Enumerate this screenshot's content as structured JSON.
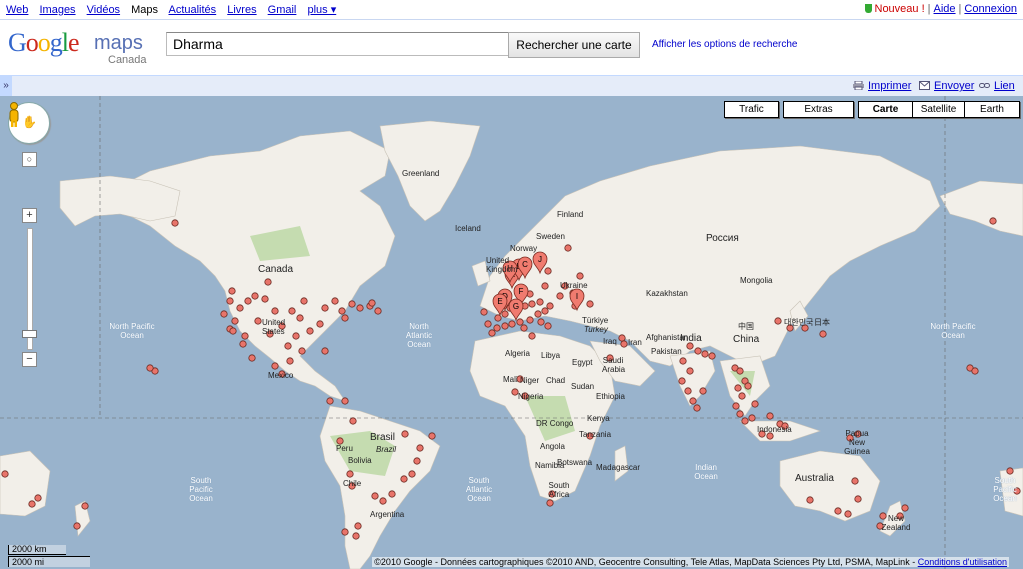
{
  "gbar": {
    "links": [
      "Web",
      "Images",
      "Vidéos",
      "Maps",
      "Actualités",
      "Livres",
      "Gmail",
      "plus ▾"
    ],
    "current": "Maps",
    "nouveau": "Nouveau !",
    "aide": "Aide",
    "connexion": "Connexion"
  },
  "header": {
    "logo_google": "Google",
    "logo_maps": "maps",
    "logo_country": "Canada",
    "search_value": "Dharma",
    "search_button": "Rechercher une carte",
    "search_options": "Afficher les options de recherche"
  },
  "toolbar": {
    "expand": "»",
    "print": "Imprimer",
    "send": "Envoyer",
    "link": "Lien"
  },
  "map": {
    "types": [
      "Trafic",
      "Extras",
      "Carte",
      "Satellite",
      "Earth"
    ],
    "scale_km": "2000 km",
    "scale_mi": "2000 mi",
    "copyright": "©2010 Google - Données cartographiques ©2010 AND, Geocentre Consulting, Tele Atlas, MapData Sciences Pty Ltd, PSMA, MapLink -",
    "terms": "Conditions d'utilisation",
    "countries": [
      "Greenland",
      "Iceland",
      "Canada",
      "United States",
      "Россия",
      "Finland",
      "Sweden",
      "Norway",
      "United Kingdom",
      "Kazakhstan",
      "中国",
      "China",
      "India",
      "Pakistan",
      "Afghanistan",
      "Iran",
      "Iraq",
      "Saudi Arabia",
      "Egypt",
      "Libya",
      "Algeria",
      "Mali",
      "Niger",
      "Chad",
      "Sudan",
      "Nigeria",
      "Ethiopia",
      "Kenya",
      "DR Congo",
      "Tanzania",
      "Angola",
      "Namibia",
      "Botswana",
      "South Africa",
      "Madagascar",
      "Brasil",
      "Brazil",
      "Peru",
      "Bolivia",
      "Chile",
      "Argentina",
      "Mexico",
      "Indonesia",
      "Australia",
      "New Zealand",
      "Papua New Guinea",
      "日本",
      "대한민국",
      "Türkiye",
      "Turkey",
      "Ukraine",
      "Mongolia"
    ],
    "oceans": [
      "North Pacific Ocean",
      "North Atlantic Ocean",
      "South Atlantic Ocean",
      "South Pacific Ocean",
      "Indian Ocean",
      "North Pacific Ocean",
      "South Pacific Ocean",
      "South Atlantic Ocean"
    ],
    "pin_letters": [
      "A",
      "B",
      "C",
      "D",
      "E",
      "F",
      "G",
      "H",
      "I",
      "J"
    ]
  },
  "colors": {
    "ocean": "#99b3cc",
    "land": "#f2efe9",
    "green": "#c5dcb0",
    "marker": "#e8746a",
    "link": "#0000cc"
  }
}
